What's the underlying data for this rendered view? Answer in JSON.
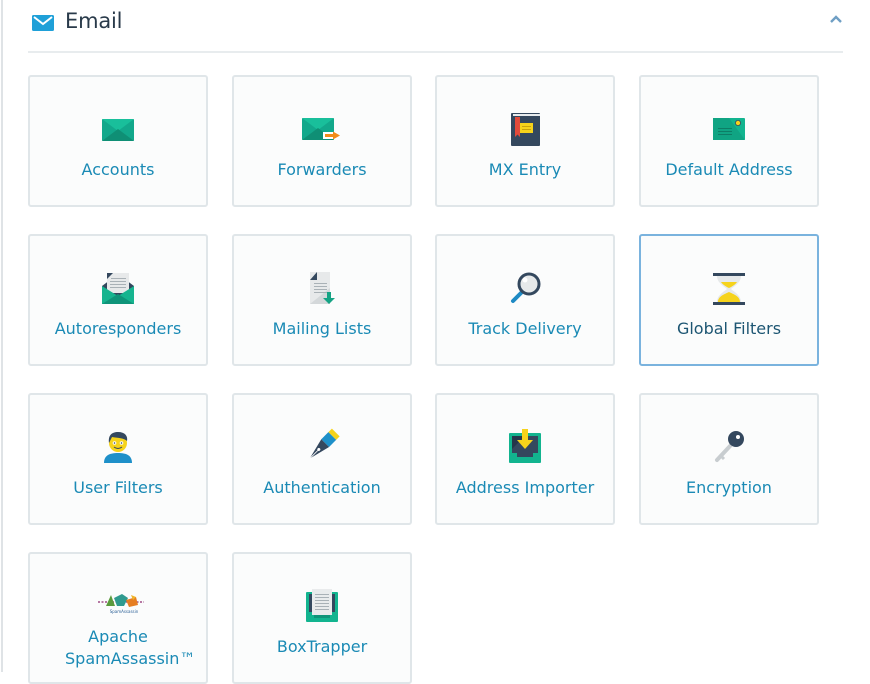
{
  "section": {
    "title": "Email",
    "icon": "envelope-icon",
    "collapse_icon": "chevron-up-icon",
    "accent_color": "#1fa0d8"
  },
  "tiles": [
    {
      "label": "Accounts",
      "icon": "email-accounts-icon"
    },
    {
      "label": "Forwarders",
      "icon": "email-forwarders-icon"
    },
    {
      "label": "MX Entry",
      "icon": "mx-entry-book-icon"
    },
    {
      "label": "Default Address",
      "icon": "default-address-envelope-icon"
    },
    {
      "label": "Autoresponders",
      "icon": "autoresponders-open-envelope-icon"
    },
    {
      "label": "Mailing Lists",
      "icon": "mailing-lists-document-icon"
    },
    {
      "label": "Track Delivery",
      "icon": "magnifier-icon"
    },
    {
      "label": "Global Filters",
      "icon": "hourglass-icon",
      "state": "hovered"
    },
    {
      "label": "User Filters",
      "icon": "user-avatar-icon"
    },
    {
      "label": "Authentication",
      "icon": "fountain-pen-icon"
    },
    {
      "label": "Address Importer",
      "icon": "inbox-import-icon"
    },
    {
      "label": "Encryption",
      "icon": "key-icon"
    },
    {
      "label": "Apache SpamAssassin™",
      "icon": "spamassassin-logo-icon",
      "logo_text": "SpamAssassin"
    },
    {
      "label": "BoxTrapper",
      "icon": "boxtrapper-tray-icon"
    }
  ]
}
